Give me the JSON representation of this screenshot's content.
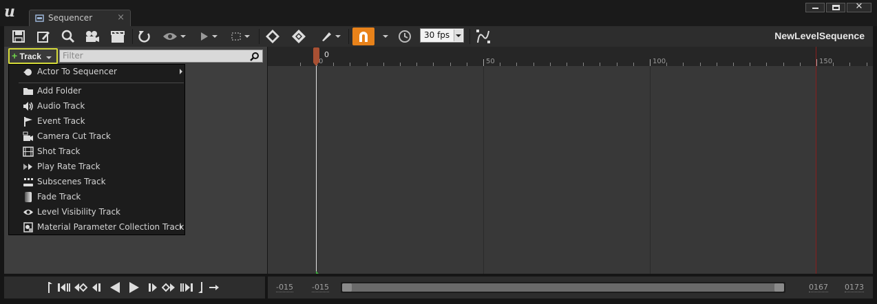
{
  "window": {
    "tab_title": "Sequencer",
    "tab_close_glyph": "×",
    "logo_text": "u",
    "controls": [
      "minimize",
      "maximize",
      "close"
    ],
    "close_glyph": "✕"
  },
  "toolbar": {
    "icons": [
      "save-icon",
      "save-as-icon",
      "find-icon",
      "render-movie-icon",
      "create-camera-icon",
      "undo-icon",
      "view-options-icon",
      "playback-options-icon",
      "select-range-icon",
      "add-key-icon",
      "key-group-icon",
      "edit-icon",
      "snap-magnet-icon",
      "time-icon",
      "curve-editor-icon"
    ],
    "fps_value": "30 fps",
    "sequence_name": "NewLevelSequence",
    "snap_color": "#e8821a"
  },
  "left_panel": {
    "track_button_label": "Track",
    "track_button_plus": "+",
    "filter_placeholder": "Filter"
  },
  "add_track_menu": {
    "items": [
      {
        "label": "Actor To Sequencer",
        "icon": "actor-icon",
        "submenu": true
      },
      {
        "label": "Add Folder",
        "icon": "folder-icon",
        "submenu": false
      },
      {
        "label": "Audio Track",
        "icon": "audio-icon",
        "submenu": false
      },
      {
        "label": "Event Track",
        "icon": "event-flag-icon",
        "submenu": false
      },
      {
        "label": "Camera Cut Track",
        "icon": "camera-cut-icon",
        "submenu": false
      },
      {
        "label": "Shot Track",
        "icon": "film-icon",
        "submenu": false
      },
      {
        "label": "Play Rate Track",
        "icon": "play-rate-icon",
        "submenu": false
      },
      {
        "label": "Subscenes Track",
        "icon": "subscenes-icon",
        "submenu": false
      },
      {
        "label": "Fade Track",
        "icon": "fade-icon",
        "submenu": false
      },
      {
        "label": "Level Visibility Track",
        "icon": "eye-icon",
        "submenu": false
      },
      {
        "label": "Material Parameter Collection Track",
        "icon": "material-icon",
        "submenu": true
      }
    ]
  },
  "timeline": {
    "current_frame": "0",
    "tick_labels": [
      "0",
      "50",
      "100",
      "150"
    ],
    "end_marker_color": "#8a1e1e",
    "start_marker_color": "#3fb33f",
    "playhead_color": "#a85033"
  },
  "transport": {
    "icons": [
      "set-start-icon",
      "to-start-icon",
      "prev-key-icon",
      "step-back-icon",
      "play-reverse-icon",
      "play-icon",
      "step-forward-icon",
      "next-key-icon",
      "to-end-icon",
      "set-end-icon",
      "loop-icon"
    ]
  },
  "range": {
    "view_start": "-015",
    "playback_start": "-015",
    "playback_end": "0167",
    "view_end": "0173"
  }
}
